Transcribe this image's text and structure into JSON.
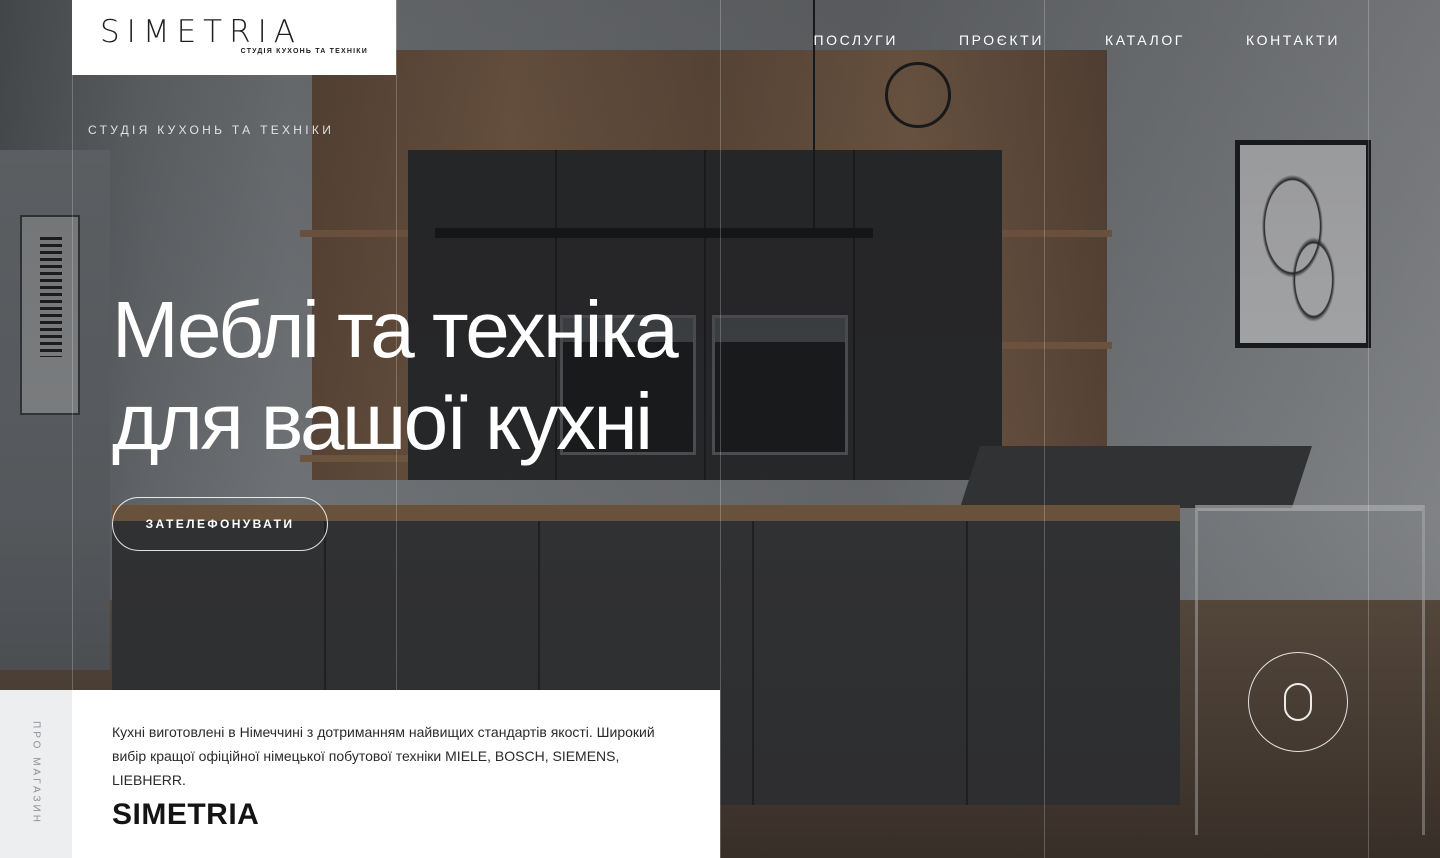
{
  "brand": {
    "logo_text": "SIMETRIA",
    "logo_tagline": "СТУДІЯ КУХОНЬ ТА ТЕХНІКИ"
  },
  "nav": {
    "items": [
      {
        "label": "ПОСЛУГИ"
      },
      {
        "label": "ПРОЄКТИ"
      },
      {
        "label": "КАТАЛОГ"
      },
      {
        "label": "КОНТАКТИ"
      }
    ]
  },
  "hero": {
    "eyebrow": "СТУДІЯ КУХОНЬ ТА ТЕХНІКИ",
    "title_line1": "Меблі та техніка",
    "title_line2": "для вашої кухні",
    "cta_label": "ЗАТЕЛЕФОНУВАТИ"
  },
  "about": {
    "side_label": "ПРО МАГАЗИН",
    "text": "Кухні виготовлені в Німеччині з дотриманням найвищих стандартів якості. Широкий вибір кращої офіційної німецької побутової техніки MIELE, BOSCH, SIEMENS, LIEBHERR.",
    "brand_name": "SIMETRIA"
  },
  "colors": {
    "accent": "#ffffff",
    "panel": "#ffffff",
    "side_strip": "#eceef0"
  },
  "icons": {
    "scroll": "mouse-scroll-icon"
  }
}
